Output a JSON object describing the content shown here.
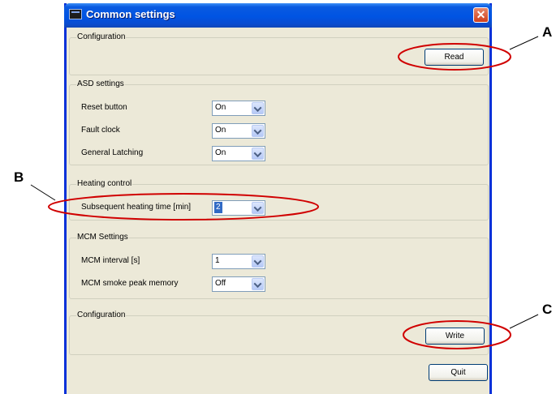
{
  "window": {
    "title": "Common settings",
    "close_symbol": "✕",
    "titlebar_color": "#0054e3",
    "frame_color": "#ece9d8"
  },
  "groups": {
    "configuration_read": {
      "title": "Configuration",
      "button_label": "Read"
    },
    "asd_settings": {
      "title": "ASD settings",
      "rows": [
        {
          "label": "Reset button",
          "value": "On"
        },
        {
          "label": "Fault clock",
          "value": "On"
        },
        {
          "label": "General Latching",
          "value": "On"
        }
      ]
    },
    "heating_control": {
      "title": "Heating control",
      "rows": [
        {
          "label": "Subsequent heating time [min]",
          "value": "2",
          "selected": true
        }
      ]
    },
    "mcm_settings": {
      "title": "MCM Settings",
      "rows": [
        {
          "label": "MCM interval [s]",
          "value": "1"
        },
        {
          "label": "MCM smoke peak memory",
          "value": "Off"
        }
      ]
    },
    "configuration_write": {
      "title": "Configuration",
      "button_label": "Write"
    }
  },
  "footer": {
    "quit_label": "Quit"
  },
  "annotations": {
    "a": "A",
    "b": "B",
    "c": "C",
    "ellipse_color": "#d00000"
  }
}
